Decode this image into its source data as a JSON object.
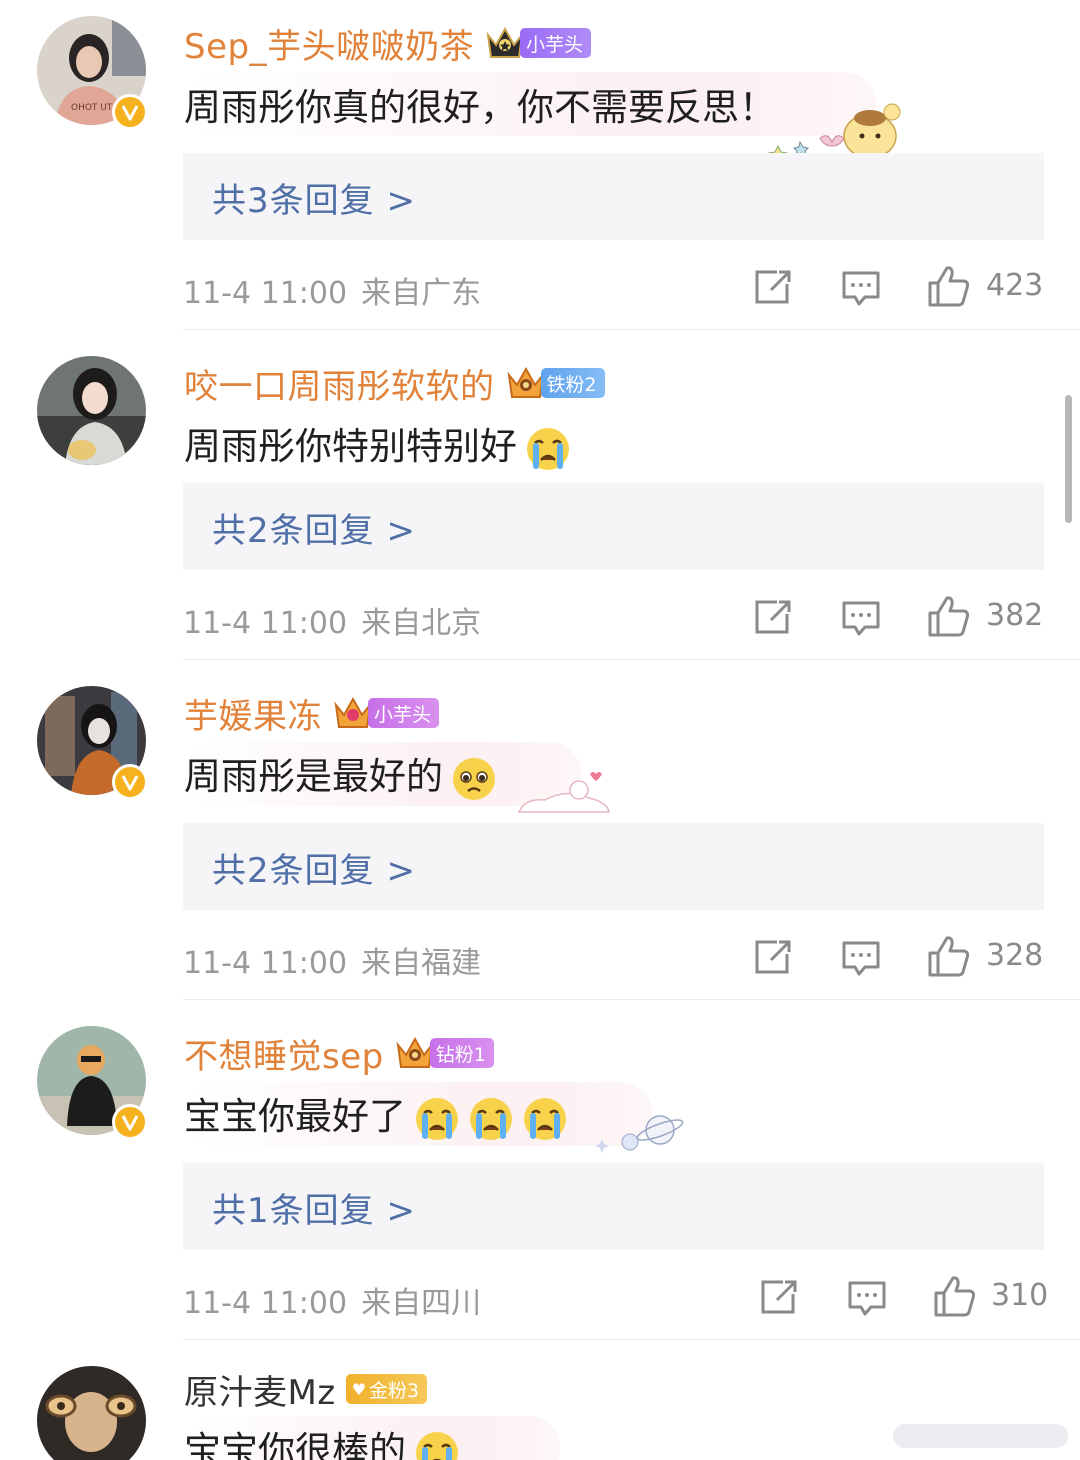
{
  "comments": [
    {
      "username": "Sep_芋头啵啵奶茶",
      "badge": "小芋头",
      "text": "周雨彤你真的很好，你不需要反思！",
      "replies": "共3条回复 >",
      "time": "11-4 11:00",
      "location": "来自广东",
      "likes": "423"
    },
    {
      "username": "咬一口周雨彤软软的",
      "badge": "铁粉2",
      "text": "周雨彤你特别特别好",
      "replies": "共2条回复 >",
      "time": "11-4 11:00",
      "location": "来自北京",
      "likes": "382"
    },
    {
      "username": "芋媛果冻",
      "badge": "小芋头",
      "text": "周雨彤是最好的",
      "replies": "共2条回复 >",
      "time": "11-4 11:00",
      "location": "来自福建",
      "likes": "328"
    },
    {
      "username": "不想睡觉sep",
      "badge": "钻粉1",
      "text": "宝宝你最好了",
      "replies": "共1条回复 >",
      "time": "11-4 11:00",
      "location": "来自四川",
      "likes": "310"
    },
    {
      "username": "原汁麦Mz",
      "badge": "金粉3",
      "text": "宝宝你很棒的"
    }
  ],
  "icons": {
    "repost": "repost-icon",
    "comment": "comment-icon",
    "like": "thumbs-up-icon",
    "verified": "verified-v-icon"
  },
  "colors": {
    "username": "#e1823a",
    "reply_link": "#4f6fa6",
    "meta": "#9a9a9a",
    "reply_bg": "#f5f5f7",
    "verified": "#f6b21e"
  }
}
